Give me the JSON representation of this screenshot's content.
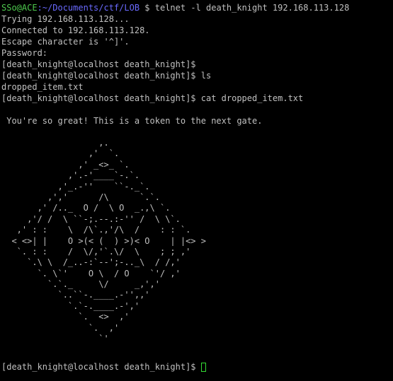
{
  "terminal": {
    "first_prompt": {
      "user_host": "SSo@ACE",
      "path": ":~/Documents/ctf/LOB",
      "command": " $ telnet -l death_knight 192.168.113.128"
    },
    "output": [
      "Trying 192.168.113.128...",
      "Connected to 192.168.113.128.",
      "Escape character is '^]'.",
      "Password:",
      "[death_knight@localhost death_knight]$",
      "[death_knight@localhost death_knight]$ ls",
      "dropped_item.txt",
      "[death_knight@localhost death_knight]$ cat dropped_item.txt",
      "",
      " You're so great! This is a token to the next gate."
    ],
    "art": [
      "                   ,.",
      "                 ,'  `.",
      "               ,' _<>_ `.",
      "             ,'.-'____`-.`.",
      "           ,'_.-''    ``-._`.",
      "         ,','      /\\      `.`.",
      "       ,' /.._  O /  \\ O  _.,\\ `.",
      "     ,'/ /  \\ ``-;.--.:-'' /  \\ \\`.",
      "   ,' : :    \\  /\\`.,'/\\  /    : : `.",
      "  < <>| |    O >(< (  ) >)< O    | |<> >",
      "   `. : :    /  \\/,'`.\\/  \\    ; ; ,'",
      "     `.\\ \\  /_..-:`--';-.._\\  / /,'",
      "       `. \\`'    O \\  / O    `'/ ,'",
      "         `.`._     \\/     _,','",
      "           `..``-.____.-'',,'",
      "             `.`-.____.-','",
      "               `.  <>  ,'",
      "                 `.  ,'",
      "                   `'"
    ],
    "final_prompt": "[death_knight@localhost death_knight]$ "
  },
  "colors": {
    "background": "#000000",
    "text": "#c0c0c0",
    "user_host": "#4ec94e",
    "path": "#6a6aff",
    "cursor": "#33dd33"
  }
}
